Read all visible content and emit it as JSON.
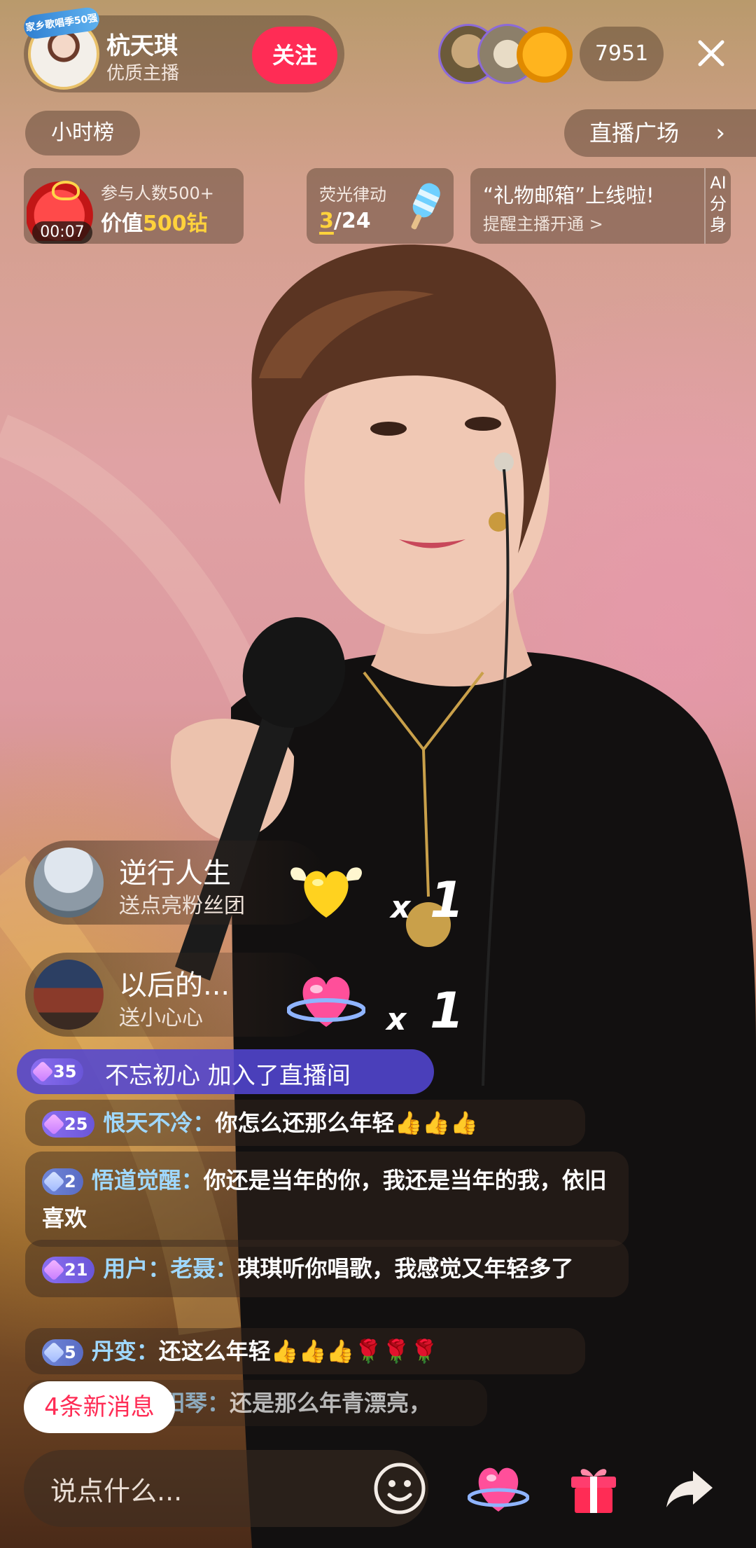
{
  "header": {
    "avatar_badge": "家乡歌唱季50强",
    "anchor_name": "杭天琪",
    "anchor_subtitle": "优质主播",
    "follow_label": "关注",
    "viewer_count": "7951"
  },
  "nav": {
    "hour_rank": "小时榜",
    "live_plaza": "直播广场"
  },
  "red_packet": {
    "timer": "00:07",
    "title": "参与人数500+",
    "value_prefix": "价值",
    "value_amount": "500钻"
  },
  "glow_task": {
    "title": "荧光律动",
    "current": "3",
    "total": "/24"
  },
  "mailbox": {
    "title": "“礼物邮箱”上线啦!",
    "subtitle": "提醒主播开通 >",
    "ai_tag": "AI分身"
  },
  "gifts": [
    {
      "user": "逆行人生",
      "action": "送点亮粉丝团",
      "x": "x",
      "count": "1",
      "icon": "yellow-heart-wings-icon"
    },
    {
      "user": "以后的...",
      "action": "送小心心",
      "x": "x",
      "count": "1",
      "icon": "pink-heart-ring-icon"
    }
  ],
  "join": {
    "level": "35",
    "text": "不忘初心 加入了直播间"
  },
  "chat": [
    {
      "level": "25",
      "user": "恨天不冷：",
      "text": "你怎么还那么年轻",
      "emoji": "👍👍👍"
    },
    {
      "level": "2",
      "user": "悟道觉醒：",
      "text": "你还是当年的你，我还是当年的我，依旧喜欢",
      "emoji": ""
    },
    {
      "level": "21",
      "user": "用户：老聂：",
      "text": "琪琪听你唱歌，我感觉又年轻多了",
      "emoji": ""
    },
    {
      "level": "5",
      "user": "丹变：",
      "text": "还这么年轻",
      "emoji": "👍👍👍🌹🌹🌹"
    },
    {
      "level": "",
      "user": "阳琴：",
      "text": "还是那么年青漂亮，",
      "emoji": ""
    }
  ],
  "new_messages": "4条新消息",
  "composer": {
    "placeholder": "说点什么..."
  },
  "colors": {
    "follow_red": "#ff2c55",
    "gold": "#ffd23c",
    "join_purple": "#5246d2",
    "username_blue": "#9fd8ff"
  }
}
